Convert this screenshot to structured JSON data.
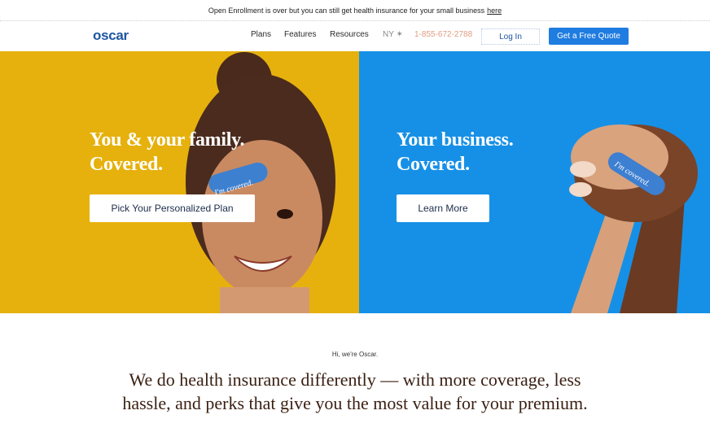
{
  "announcement": {
    "text": "Open Enrollment is over but you can still get health insurance for your small business",
    "link": "here"
  },
  "nav": {
    "logo": "oscar",
    "links": [
      "Plans",
      "Features",
      "Resources"
    ],
    "state": "NY ✶",
    "phone": "1-855-672-2788",
    "login": "Log In",
    "quote": "Get a Free Quote"
  },
  "hero": {
    "left": {
      "title_line1": "You & your family.",
      "title_line2": "Covered.",
      "button": "Pick Your Personalized Plan",
      "bandage_text": "I'm covered."
    },
    "right": {
      "title_line1": "Your business.",
      "title_line2": "Covered.",
      "button": "Learn More",
      "bandage_text": "I'm covered."
    }
  },
  "intro": {
    "greeting": "Hi, we're Oscar.",
    "headline": "We do health insurance differently — with more coverage, less hassle, and perks that give you the most value for your premium."
  },
  "colors": {
    "left_panel": "#e6b10d",
    "right_panel": "#1690e6",
    "brand_blue": "#1e55a0",
    "cta_blue": "#1f7ce0",
    "phone": "#e39b80",
    "headline": "#3a1f12"
  }
}
